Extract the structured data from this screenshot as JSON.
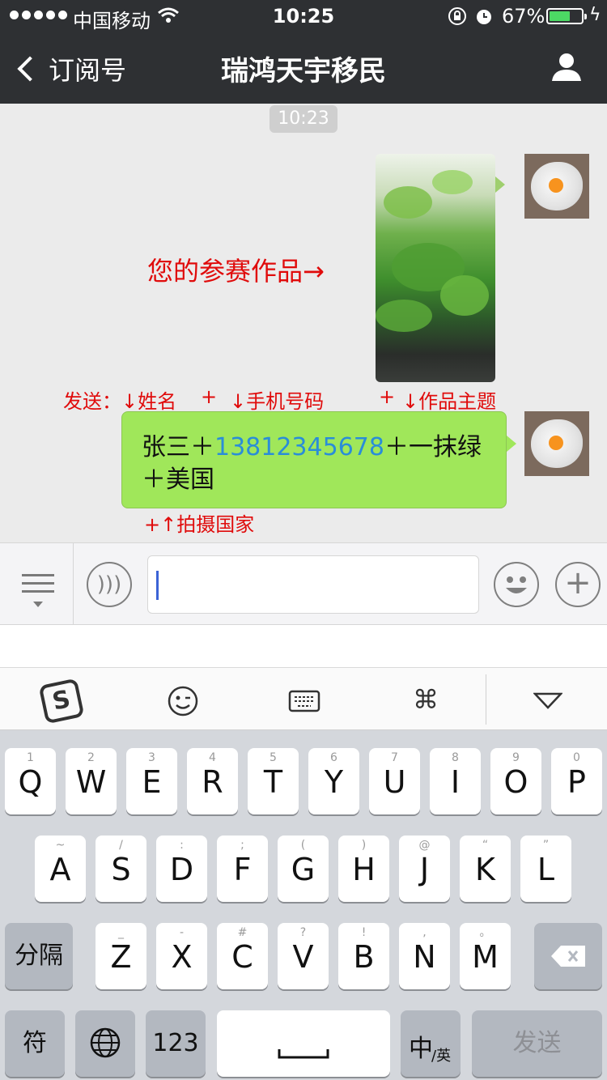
{
  "status_bar": {
    "carrier": "中国移动",
    "time": "10:25",
    "battery_pct": "67%",
    "battery_level": 0.67
  },
  "nav": {
    "back_label": "订阅号",
    "title": "瑞鸿天宇移民"
  },
  "chat": {
    "timestamp": "10:23",
    "photo_caption": "您的参赛作品→",
    "hint_top": [
      "发送：↓姓名",
      "+",
      "↓手机号码",
      "+",
      "↓作品主题"
    ],
    "message_line1_prefix": "张三＋",
    "message_phone": "13812345678",
    "message_line1_suffix": "＋一抹绿",
    "message_line2": "＋美国",
    "hint_bottom": "+↑拍摄国家"
  },
  "keyboard": {
    "row1": [
      {
        "letter": "Q",
        "num": "1"
      },
      {
        "letter": "W",
        "num": "2"
      },
      {
        "letter": "E",
        "num": "3"
      },
      {
        "letter": "R",
        "num": "4"
      },
      {
        "letter": "T",
        "num": "5"
      },
      {
        "letter": "Y",
        "num": "6"
      },
      {
        "letter": "U",
        "num": "7"
      },
      {
        "letter": "I",
        "num": "8"
      },
      {
        "letter": "O",
        "num": "9"
      },
      {
        "letter": "P",
        "num": "0"
      }
    ],
    "row2": [
      {
        "letter": "A",
        "num": "~"
      },
      {
        "letter": "S",
        "num": "/"
      },
      {
        "letter": "D",
        "num": ":"
      },
      {
        "letter": "F",
        "num": ";"
      },
      {
        "letter": "G",
        "num": "("
      },
      {
        "letter": "H",
        "num": ")"
      },
      {
        "letter": "J",
        "num": "@"
      },
      {
        "letter": "K",
        "num": "“"
      },
      {
        "letter": "L",
        "num": "”"
      }
    ],
    "row3": [
      {
        "letter": "Z",
        "num": "_"
      },
      {
        "letter": "X",
        "num": "-"
      },
      {
        "letter": "C",
        "num": "#"
      },
      {
        "letter": "V",
        "num": "?"
      },
      {
        "letter": "B",
        "num": "!"
      },
      {
        "letter": "N",
        "num": ","
      },
      {
        "letter": "M",
        "num": "。"
      }
    ],
    "separator_key": "分隔",
    "symbol_key": "符",
    "number_key": "123",
    "lang_key_main": "中",
    "lang_key_sub": "/英",
    "send_key": "发送"
  },
  "colors": {
    "nav_bg": "#2e3033",
    "bubble_bg": "#a0e75a",
    "hint_red": "#e00b0b",
    "phone_link": "#2a8dd8"
  }
}
